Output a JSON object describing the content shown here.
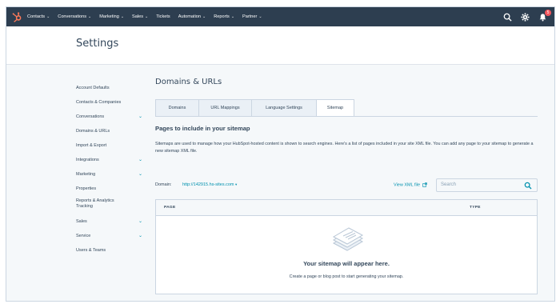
{
  "topnav": {
    "items": [
      {
        "label": "Contacts",
        "dropdown": true
      },
      {
        "label": "Conversations",
        "dropdown": true
      },
      {
        "label": "Marketing",
        "dropdown": true
      },
      {
        "label": "Sales",
        "dropdown": true
      },
      {
        "label": "Tickets",
        "dropdown": false
      },
      {
        "label": "Automation",
        "dropdown": true
      },
      {
        "label": "Reports",
        "dropdown": true
      },
      {
        "label": "Partner",
        "dropdown": true
      }
    ],
    "notification_count": "5",
    "icons": [
      "sprocket-logo-icon",
      "search-icon",
      "gear-icon",
      "bell-icon"
    ]
  },
  "header": {
    "title": "Settings"
  },
  "sidebar": {
    "items": [
      {
        "label": "Account Defaults",
        "expandable": false
      },
      {
        "label": "Contacts & Companies",
        "expandable": false
      },
      {
        "label": "Conversations",
        "expandable": true
      },
      {
        "label": "Domains & URLs",
        "expandable": false
      },
      {
        "label": "Import & Export",
        "expandable": false
      },
      {
        "label": "Integrations",
        "expandable": true
      },
      {
        "label": "Marketing",
        "expandable": true
      },
      {
        "label": "Properties",
        "expandable": false
      },
      {
        "label": "Reports & Analytics Tracking",
        "expandable": false
      },
      {
        "label": "Sales",
        "expandable": true
      },
      {
        "label": "Service",
        "expandable": true
      },
      {
        "label": "Users & Teams",
        "expandable": false
      }
    ]
  },
  "main": {
    "title": "Domains & URLs",
    "tabs": [
      {
        "label": "Domains",
        "active": false
      },
      {
        "label": "URL Mappings",
        "active": false
      },
      {
        "label": "Language Settings",
        "active": false
      },
      {
        "label": "Sitemap",
        "active": true
      }
    ],
    "section_title": "Pages to include in your sitemap",
    "section_desc": "Sitemaps are used to manage how your HubSpot-hosted content is shown to search engines. Here's a list of pages included in your site XML file. You can add any page to your sitemap to generate a new sitemap XML file.",
    "domain_label": "Domain:",
    "domain_value": "http://142915.hs-sites.com",
    "view_xml_label": "View XML file",
    "search_placeholder": "Search",
    "table": {
      "columns": [
        "PAGE",
        "TYPE"
      ],
      "empty_title": "Your sitemap will appear here.",
      "empty_subtitle": "Create a page or blog post to start generating your sitemap."
    }
  },
  "colors": {
    "nav_bg": "#2d3e50",
    "accent": "#0091ae",
    "logo": "#ff7a59",
    "text": "#33475b",
    "badge": "#f2545b"
  }
}
